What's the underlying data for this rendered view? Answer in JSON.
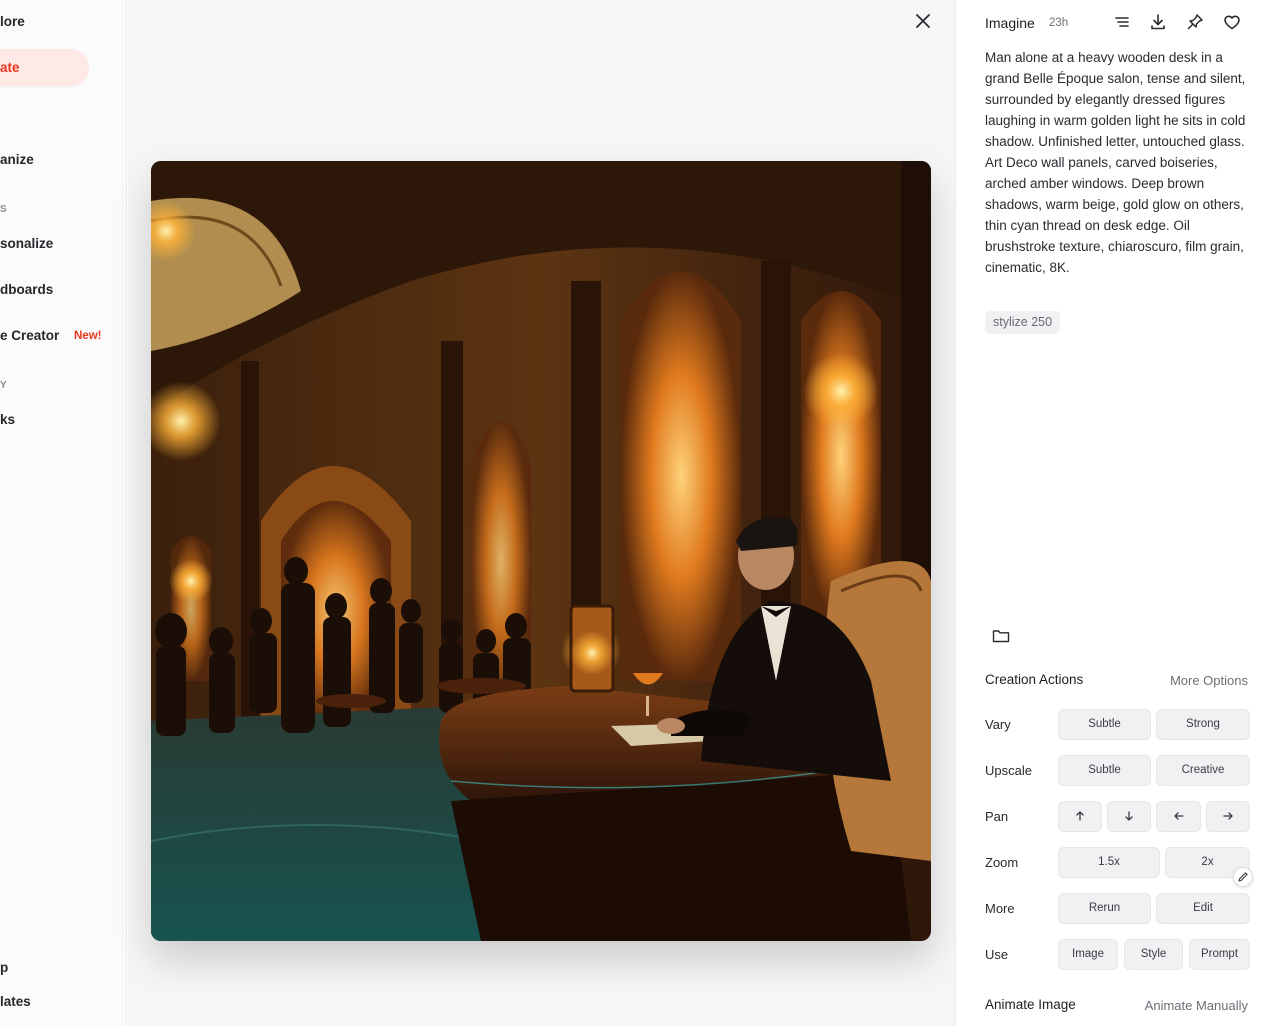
{
  "sidebar": {
    "items": [
      {
        "label": "lore"
      },
      {
        "label": "ate"
      },
      {
        "label": "anize"
      },
      {
        "label": "sonalize"
      },
      {
        "label": "dboards"
      },
      {
        "label": "e Creator"
      },
      {
        "label": "ks"
      },
      {
        "label": "p"
      },
      {
        "label": "lates"
      }
    ],
    "sections": [
      "S",
      "Y"
    ],
    "new_badge": "New!"
  },
  "header": {
    "title": "Imagine",
    "time": "23h",
    "icons": [
      "list-icon",
      "download-icon",
      "pin-icon",
      "heart-icon"
    ]
  },
  "prompt": "Man alone at a heavy wooden desk in a grand Belle Époque salon, tense and silent, surrounded by elegantly dressed figures laughing in warm golden light he sits in cold shadow. Unfinished letter, untouched glass. Art Deco wall panels, carved boiseries, arched amber windows. Deep brown shadows, warm beige, gold glow on others, thin cyan thread on desk edge. Oil brushstroke texture, chiaroscuro, film grain, cinematic, 8K.",
  "param": "stylize 250",
  "creation": {
    "title": "Creation Actions",
    "more_options": "More Options",
    "rows": [
      {
        "label": "Vary",
        "buttons": [
          "Subtle",
          "Strong"
        ]
      },
      {
        "label": "Upscale",
        "buttons": [
          "Subtle",
          "Creative"
        ]
      },
      {
        "label": "Pan",
        "buttons": [
          "arrow-up-icon",
          "arrow-down-icon",
          "arrow-left-icon",
          "arrow-right-icon"
        ]
      },
      {
        "label": "Zoom",
        "buttons": [
          "1.5x",
          "2x"
        ]
      },
      {
        "label": "More",
        "buttons": [
          "Rerun",
          "Edit"
        ]
      },
      {
        "label": "Use",
        "buttons": [
          "Image",
          "Style",
          "Prompt"
        ]
      }
    ]
  },
  "animate": {
    "title": "Animate Image",
    "link": "Animate Manually"
  },
  "colors": {
    "accent": "#e8381d",
    "accent_bg": "#ffe9e6"
  }
}
